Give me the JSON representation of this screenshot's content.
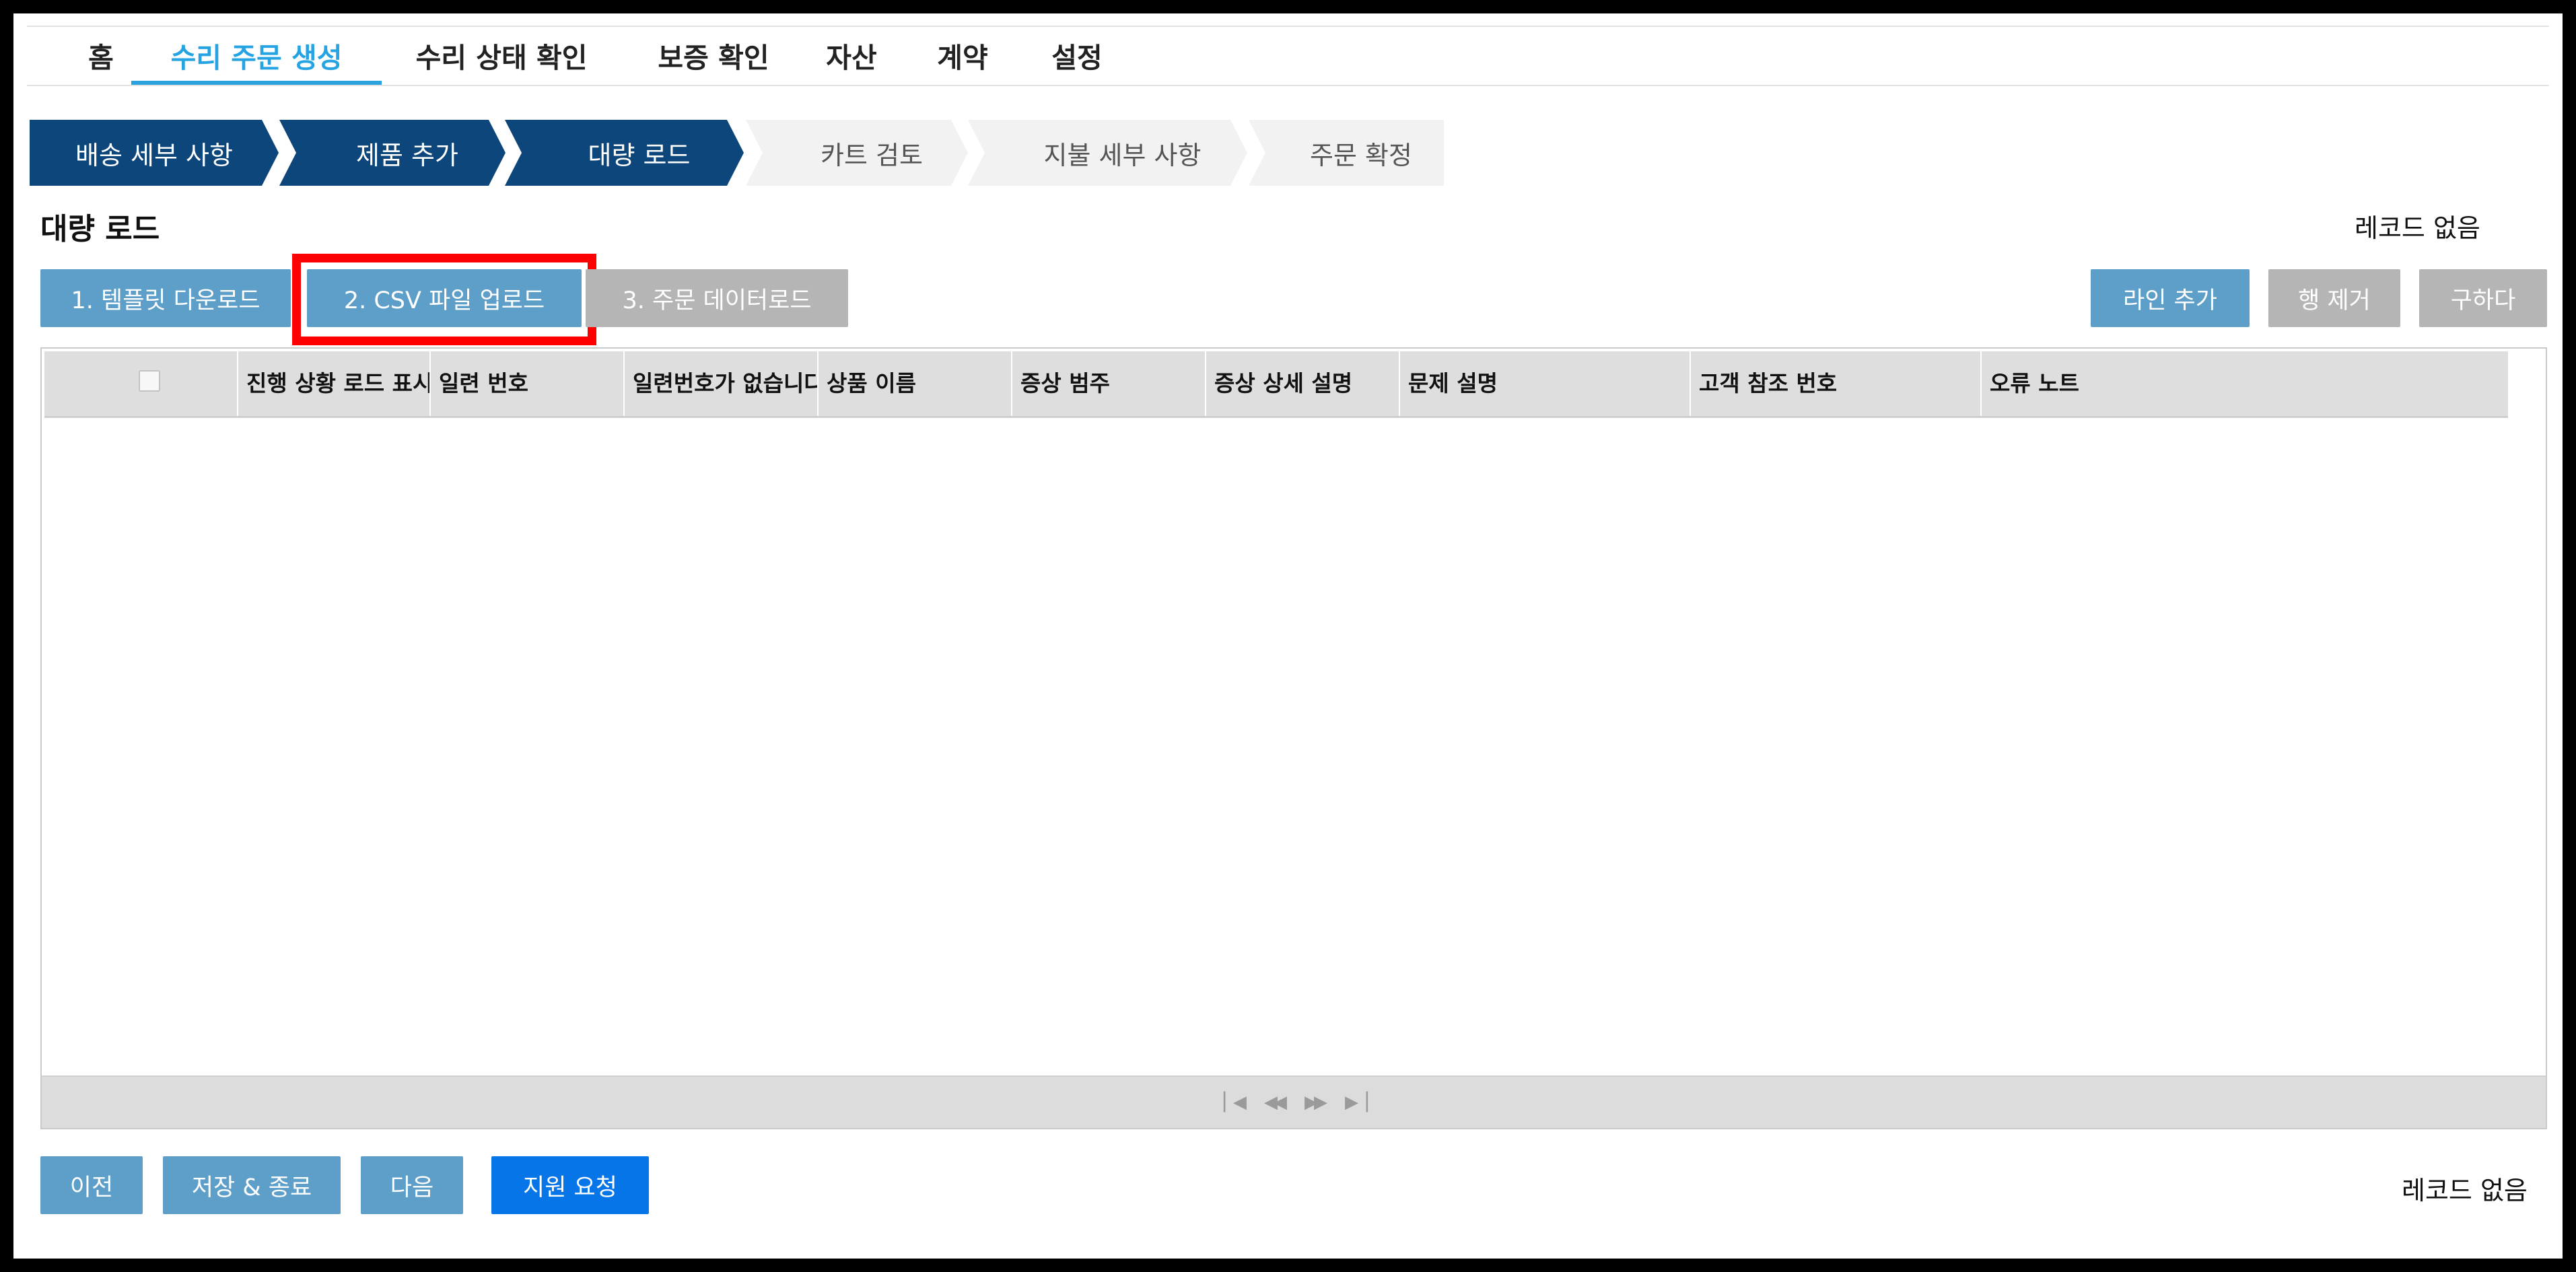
{
  "nav": {
    "items": [
      {
        "label": "홈"
      },
      {
        "label": "수리 주문 생성"
      },
      {
        "label": "수리 상태 확인"
      },
      {
        "label": "보증 확인"
      },
      {
        "label": "자산"
      },
      {
        "label": "계약"
      },
      {
        "label": "설정"
      }
    ],
    "active_index": 1,
    "active_color": "#25a3e2"
  },
  "steps": [
    {
      "label": "배송 세부 사항",
      "state": "done"
    },
    {
      "label": "제품 추가",
      "state": "done"
    },
    {
      "label": "대량 로드",
      "state": "done"
    },
    {
      "label": "카트 검토",
      "state": "todo"
    },
    {
      "label": "지불 세부 사항",
      "state": "todo"
    },
    {
      "label": "주문 확정",
      "state": "todo"
    }
  ],
  "section": {
    "title": "대량 로드",
    "records_label": "레코드 없음"
  },
  "toolbar": {
    "template_download": "1. 템플릿 다운로드",
    "csv_upload": "2. CSV 파일 업로드",
    "order_data_load": "3. 주문 데이터로드",
    "add_line": "라인 추가",
    "remove_row": "행 제거",
    "apply": "구하다"
  },
  "grid": {
    "columns": [
      {
        "label": "진행 상황 로드 표시기"
      },
      {
        "label": "일련 번호"
      },
      {
        "label": "일련번호가 없습니다"
      },
      {
        "label": "상품 이름"
      },
      {
        "label": "증상 범주"
      },
      {
        "label": "증상 상세 설명"
      },
      {
        "label": "문제 설명"
      },
      {
        "label": "고객 참조 번호"
      },
      {
        "label": "오류 노트"
      }
    ],
    "rows": []
  },
  "footer": {
    "prev": "이전",
    "save_exit": "저장 & 종료",
    "next": "다음",
    "support": "지원 요청",
    "records_label": "레코드 없음"
  },
  "colors": {
    "step_done": "#0d467a",
    "step_todo": "#f2f2f2",
    "button_blue": "#5e9fc9",
    "button_gray": "#b5b5b5",
    "button_primary": "#0675e8",
    "highlight": "#ff0000"
  },
  "icons": {
    "pager": [
      "first-page-icon",
      "prev-page-icon",
      "next-page-icon",
      "last-page-icon"
    ]
  }
}
